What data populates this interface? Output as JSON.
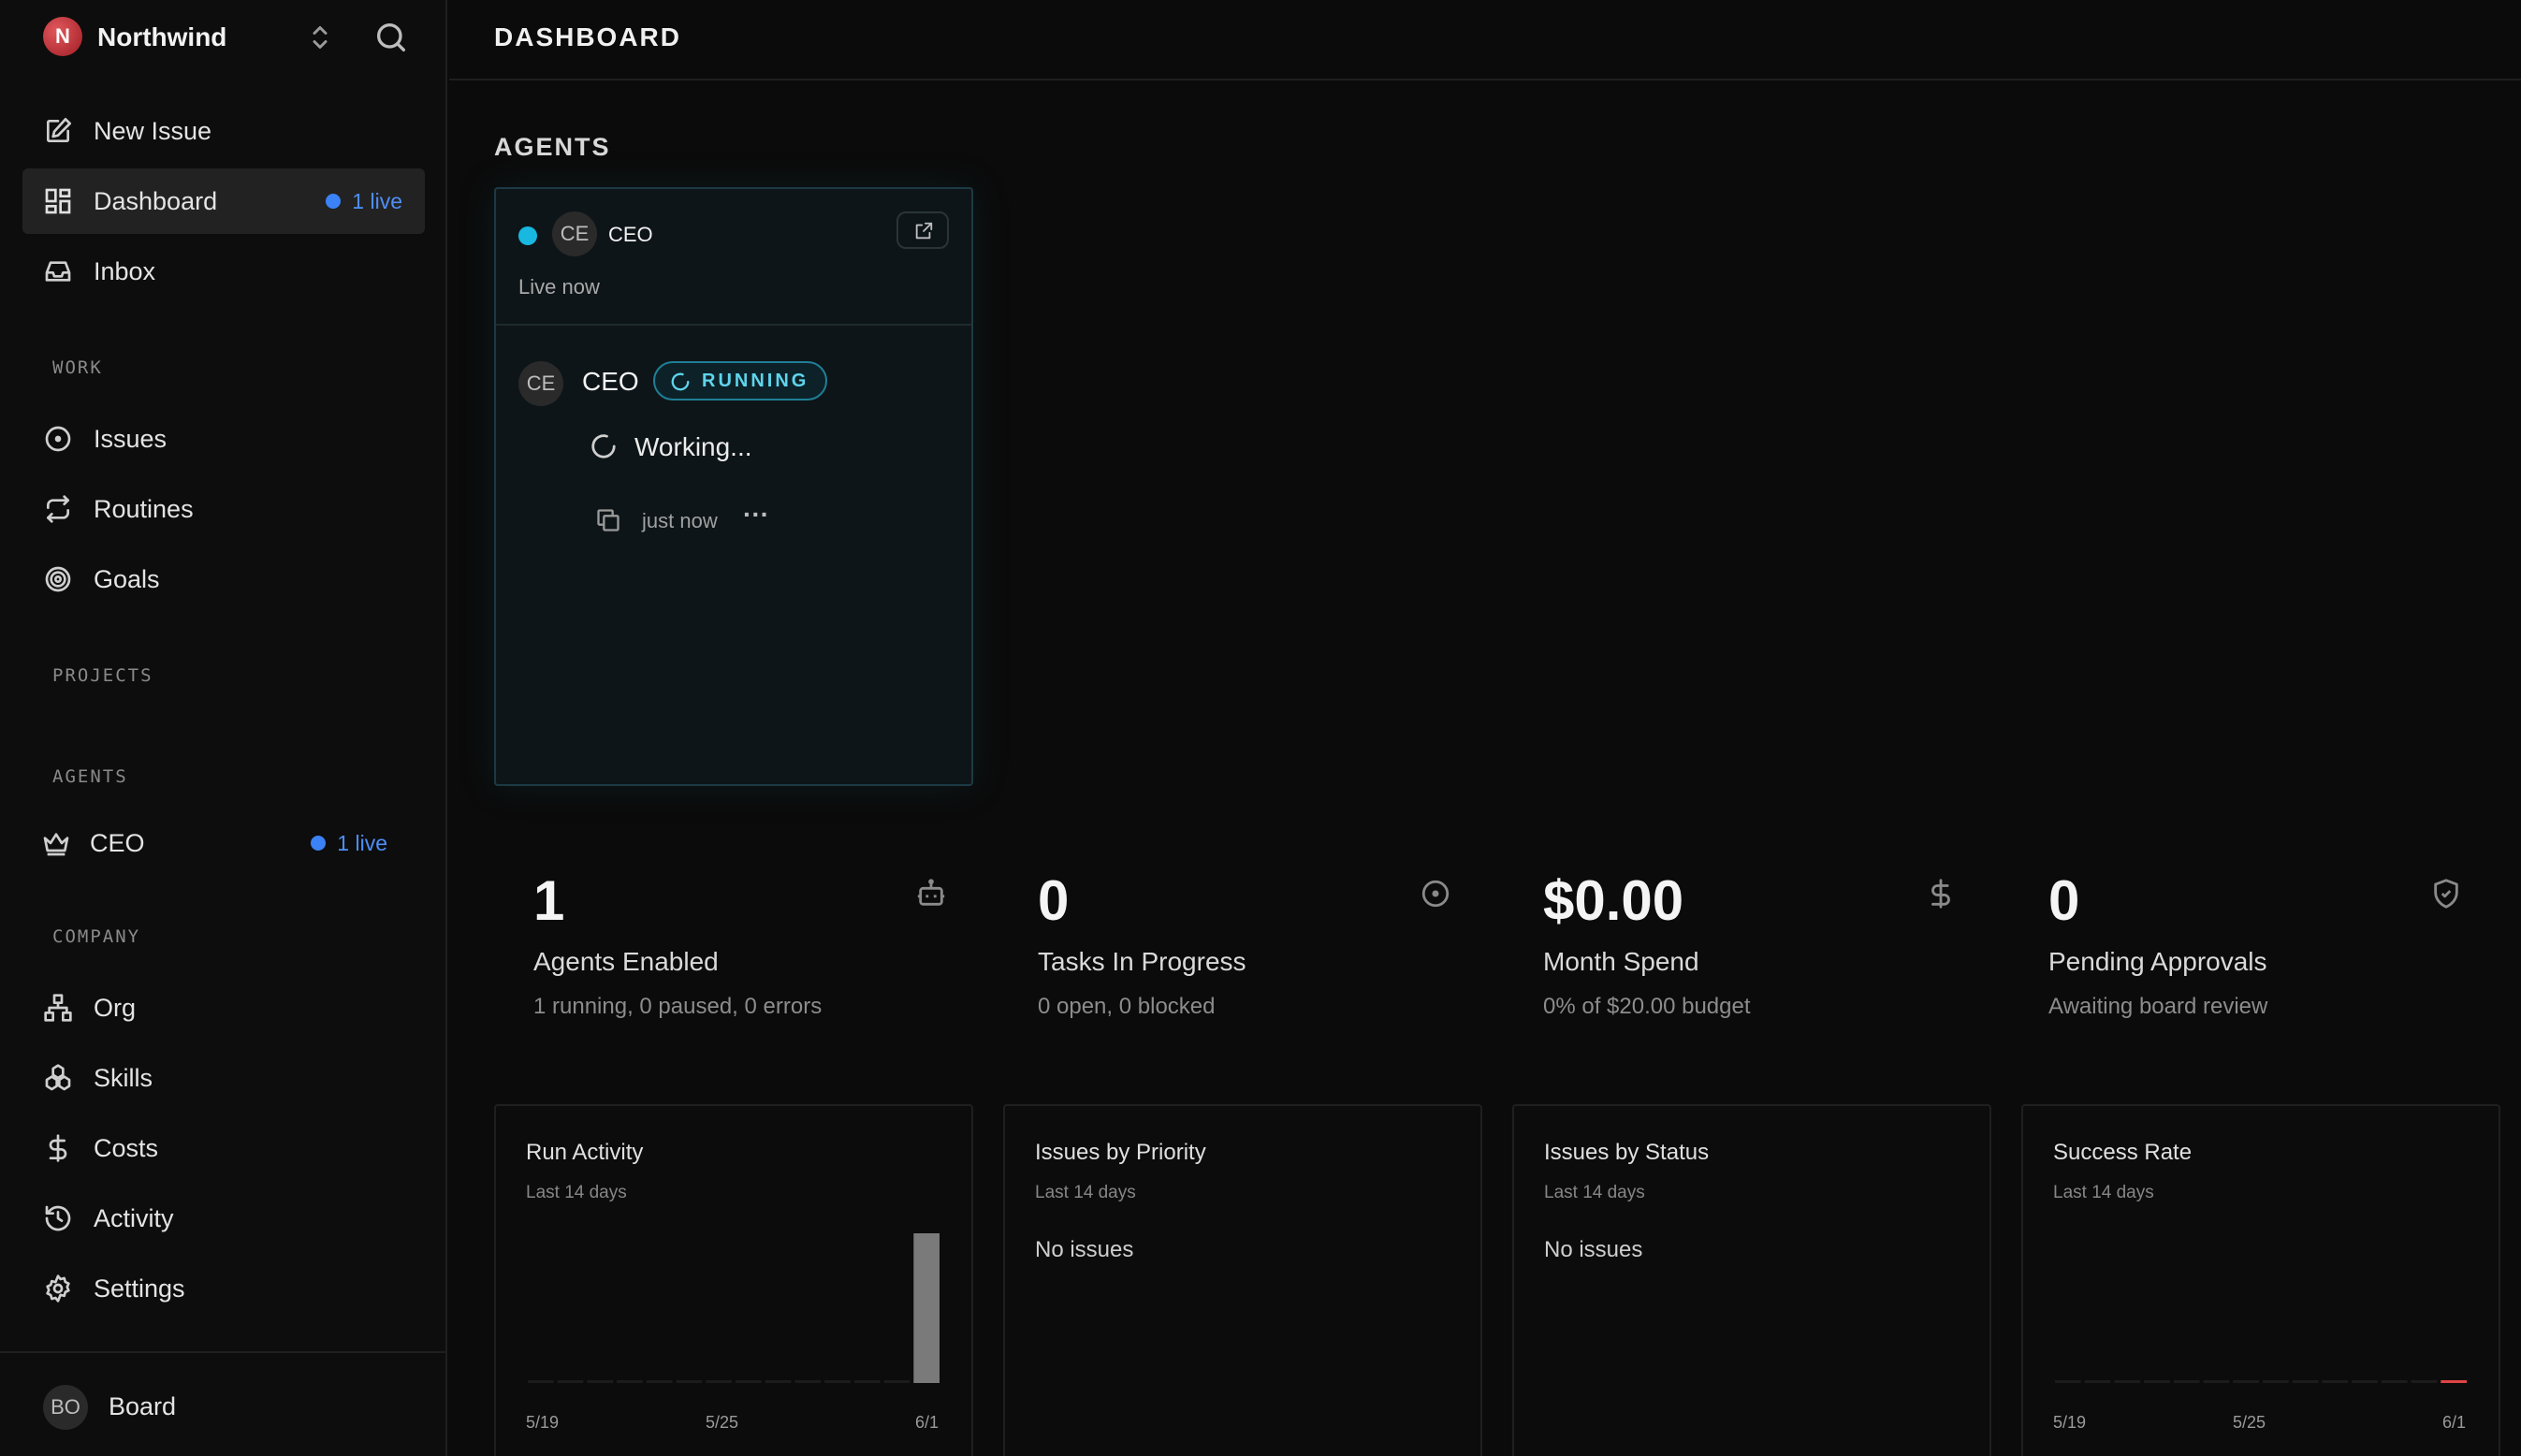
{
  "brand": {
    "initial": "N",
    "name": "Northwind"
  },
  "nav": {
    "new_issue": "New Issue",
    "dashboard": "Dashboard",
    "dashboard_badge": "1 live",
    "inbox": "Inbox"
  },
  "sections": {
    "work": "WORK",
    "projects": "PROJECTS",
    "agents": "AGENTS",
    "company": "COMPANY"
  },
  "work_items": {
    "issues": "Issues",
    "routines": "Routines",
    "goals": "Goals"
  },
  "agent_items": {
    "ceo": "CEO",
    "ceo_badge": "1 live"
  },
  "company_items": {
    "org": "Org",
    "skills": "Skills",
    "costs": "Costs",
    "activity": "Activity",
    "settings": "Settings"
  },
  "footer": {
    "avatar": "BO",
    "name": "Board"
  },
  "header": {
    "title": "DASHBOARD"
  },
  "agents_section": {
    "heading": "AGENTS",
    "card": {
      "avatar": "CE",
      "name": "CEO",
      "status_text": "Live now",
      "run": {
        "avatar": "CE",
        "name": "CEO",
        "badge": "RUNNING",
        "message": "Working...",
        "time": "just now",
        "more": "···"
      }
    }
  },
  "stats": [
    {
      "value": "1",
      "label": "Agents Enabled",
      "sub": "1 running, 0 paused, 0 errors",
      "icon": "robot-icon"
    },
    {
      "value": "0",
      "label": "Tasks In Progress",
      "sub": "0 open, 0 blocked",
      "icon": "circle-dot-icon"
    },
    {
      "value": "$0.00",
      "label": "Month Spend",
      "sub": "0% of $20.00 budget",
      "icon": "dollar-icon"
    },
    {
      "value": "0",
      "label": "Pending Approvals",
      "sub": "Awaiting board review",
      "icon": "shield-icon"
    }
  ],
  "charts": {
    "run_activity": {
      "title": "Run Activity",
      "sub": "Last 14 days",
      "ticks": [
        "5/19",
        "5/25",
        "6/1"
      ]
    },
    "issues_priority": {
      "title": "Issues by Priority",
      "sub": "Last 14 days",
      "empty": "No issues"
    },
    "issues_status": {
      "title": "Issues by Status",
      "sub": "Last 14 days",
      "empty": "No issues"
    },
    "success_rate": {
      "title": "Success Rate",
      "sub": "Last 14 days",
      "ticks": [
        "5/19",
        "5/25",
        "6/1"
      ]
    }
  },
  "colors": {
    "accent_blue": "#3b82f6",
    "live_cyan": "#18b8e0",
    "running_border": "#1f7f96",
    "run_bar": "#7a7a7a",
    "failure_red": "#e04444"
  },
  "chart_data": [
    {
      "type": "bar",
      "title": "Run Activity",
      "categories": [
        "5/19",
        "5/20",
        "5/21",
        "5/22",
        "5/23",
        "5/24",
        "5/25",
        "5/26",
        "5/27",
        "5/28",
        "5/29",
        "5/30",
        "5/31",
        "6/1"
      ],
      "values": [
        0,
        0,
        0,
        0,
        0,
        0,
        0,
        0,
        0,
        0,
        0,
        0,
        0,
        1
      ]
    },
    {
      "type": "bar",
      "title": "Success Rate",
      "categories": [
        "5/19",
        "5/20",
        "5/21",
        "5/22",
        "5/23",
        "5/24",
        "5/25",
        "5/26",
        "5/27",
        "5/28",
        "5/29",
        "5/30",
        "5/31",
        "6/1"
      ],
      "values": [
        0,
        0,
        0,
        0,
        0,
        0,
        0,
        0,
        0,
        0,
        0,
        0,
        0,
        0
      ]
    }
  ]
}
